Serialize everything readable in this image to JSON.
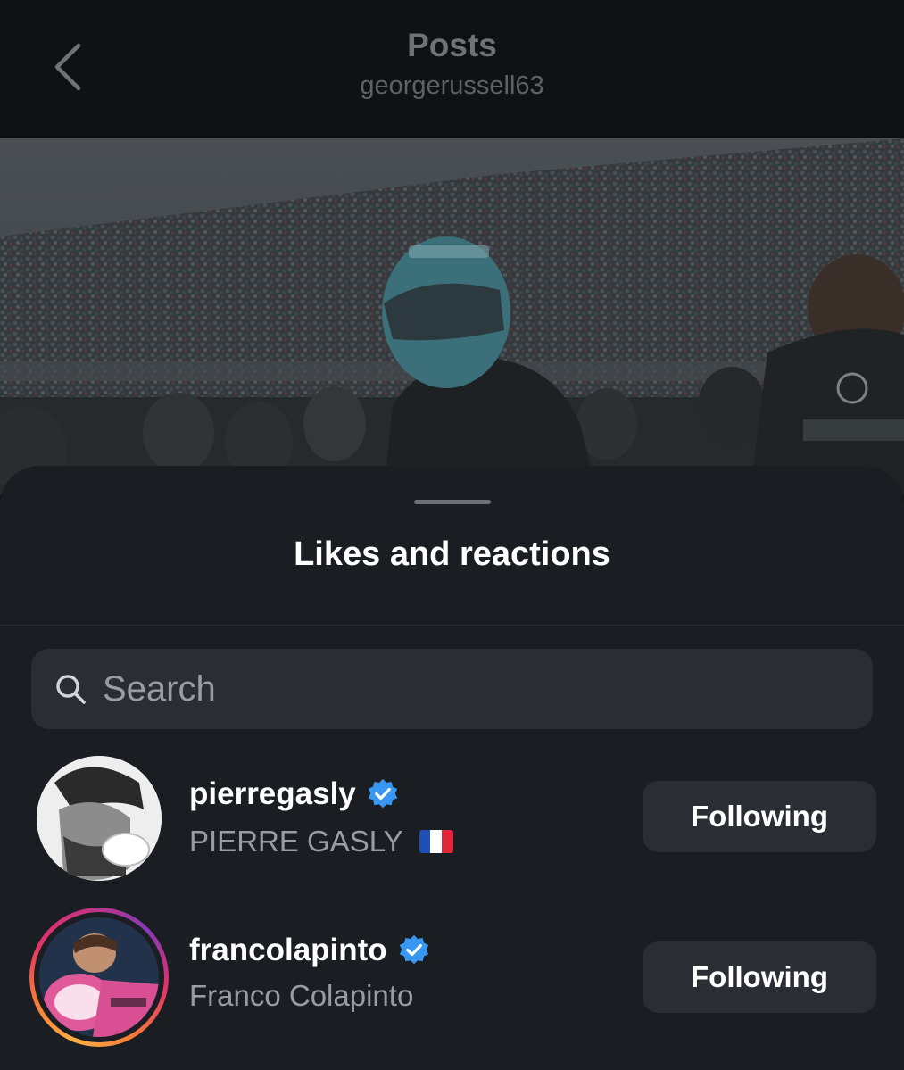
{
  "header": {
    "title": "Posts",
    "subtitle": "georgerussell63"
  },
  "sheet": {
    "title": "Likes and reactions"
  },
  "search": {
    "placeholder": "Search"
  },
  "likes": [
    {
      "username": "pierregasly",
      "full_name": "PIERRE GASLY",
      "verified": true,
      "button_label": "Following",
      "flag": "🇫🇷"
    },
    {
      "username": "francolapinto",
      "full_name": "Franco Colapinto",
      "verified": true,
      "button_label": "Following",
      "story_ring": true
    }
  ],
  "colors": {
    "background": "#121416",
    "sheet": "#1a1d21",
    "button": "#2a2e34",
    "verified": "#3897f0",
    "text_primary": "#ffffff",
    "text_secondary": "#9a9ca1"
  },
  "icons": {
    "back": "chevron-left-icon",
    "search": "search-icon",
    "verified": "verified-badge-icon"
  }
}
